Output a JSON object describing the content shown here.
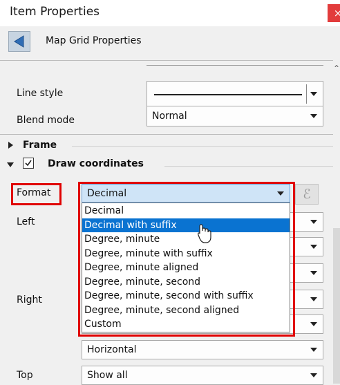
{
  "window": {
    "title": "Item Properties",
    "close_glyph": "×"
  },
  "header": {
    "title": "Map Grid Properties",
    "back_icon": "left-triangle-icon"
  },
  "line_style": {
    "label": "Line style"
  },
  "blend_mode": {
    "label": "Blend mode",
    "value": "Normal"
  },
  "frame": {
    "label": "Frame"
  },
  "draw_coordinates": {
    "label": "Draw coordinates",
    "checked": true
  },
  "format": {
    "label": "Format",
    "value": "Decimal",
    "expression_glyph": "ℰ"
  },
  "format_options": [
    "Decimal",
    "Decimal with suffix",
    "Degree, minute",
    "Degree, minute with suffix",
    "Degree, minute aligned",
    "Degree, minute, second",
    "Degree, minute, second with suffix",
    "Degree, minute, second aligned",
    "Custom"
  ],
  "highlighted_option": "Decimal with suffix",
  "left": {
    "label": "Left"
  },
  "right": {
    "label": "Right"
  },
  "direction": {
    "value": "Horizontal"
  },
  "top": {
    "label": "Top",
    "value": "Show all"
  },
  "colors": {
    "highlight": "#0a73d1",
    "annotation_red": "#e00000",
    "close_red": "#e23c3c"
  }
}
